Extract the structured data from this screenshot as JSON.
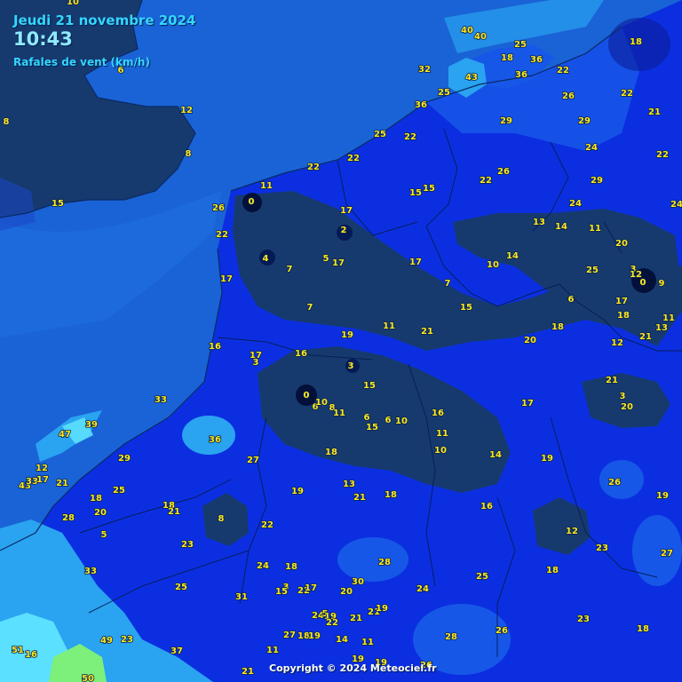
{
  "header": {
    "date": "Jeudi 21 novembre 2024",
    "time": "10:43",
    "parameter": "Rafales de vent (km/h)"
  },
  "copyright": "Copyright © 2024 Meteociel.fr",
  "colors": {
    "land_dark": "#163a6e",
    "land_mid": "#0b2fe0",
    "sea": "#1a63d6",
    "sea_light": "#2aa3f0",
    "strong": "#5be0ff",
    "very_strong": "#7cf07a",
    "label": "#ffe81f"
  },
  "stations": [
    {
      "v": "10"
    },
    {
      "v": "6"
    },
    {
      "v": "8"
    },
    {
      "v": "12"
    },
    {
      "v": "8"
    },
    {
      "v": "15"
    },
    {
      "v": "40"
    },
    {
      "v": "40"
    },
    {
      "v": "25"
    },
    {
      "v": "18"
    },
    {
      "v": "36"
    },
    {
      "v": "22"
    },
    {
      "v": "18"
    },
    {
      "v": "32"
    },
    {
      "v": "43"
    },
    {
      "v": "36"
    },
    {
      "v": "25"
    },
    {
      "v": "26"
    },
    {
      "v": "22"
    },
    {
      "v": "36"
    },
    {
      "v": "29"
    },
    {
      "v": "29"
    },
    {
      "v": "21"
    },
    {
      "v": "25"
    },
    {
      "v": "22"
    },
    {
      "v": "24"
    },
    {
      "v": "22"
    },
    {
      "v": "22"
    },
    {
      "v": "22"
    },
    {
      "v": "26"
    },
    {
      "v": "22"
    },
    {
      "v": "29"
    },
    {
      "v": "11"
    },
    {
      "v": "15"
    },
    {
      "v": "15"
    },
    {
      "v": "0"
    },
    {
      "v": "26"
    },
    {
      "v": "24"
    },
    {
      "v": "24"
    },
    {
      "v": "17"
    },
    {
      "v": "13"
    },
    {
      "v": "14"
    },
    {
      "v": "11"
    },
    {
      "v": "22"
    },
    {
      "v": "2"
    },
    {
      "v": "20"
    },
    {
      "v": "4"
    },
    {
      "v": "5"
    },
    {
      "v": "17"
    },
    {
      "v": "17"
    },
    {
      "v": "14"
    },
    {
      "v": "10"
    },
    {
      "v": "7"
    },
    {
      "v": "25"
    },
    {
      "v": "3"
    },
    {
      "v": "12"
    },
    {
      "v": "0"
    },
    {
      "v": "9"
    },
    {
      "v": "17"
    },
    {
      "v": "7"
    },
    {
      "v": "6"
    },
    {
      "v": "17"
    },
    {
      "v": "7"
    },
    {
      "v": "15"
    },
    {
      "v": "18"
    },
    {
      "v": "11"
    },
    {
      "v": "19"
    },
    {
      "v": "11"
    },
    {
      "v": "21"
    },
    {
      "v": "20"
    },
    {
      "v": "18"
    },
    {
      "v": "12"
    },
    {
      "v": "21"
    },
    {
      "v": "13"
    },
    {
      "v": "16"
    },
    {
      "v": "17"
    },
    {
      "v": "16"
    },
    {
      "v": "3"
    },
    {
      "v": "3"
    },
    {
      "v": "15"
    },
    {
      "v": "21"
    },
    {
      "v": "33"
    },
    {
      "v": "0"
    },
    {
      "v": "3"
    },
    {
      "v": "20"
    },
    {
      "v": "6"
    },
    {
      "v": "10"
    },
    {
      "v": "8"
    },
    {
      "v": "11"
    },
    {
      "v": "16"
    },
    {
      "v": "17"
    },
    {
      "v": "39"
    },
    {
      "v": "6"
    },
    {
      "v": "6"
    },
    {
      "v": "10"
    },
    {
      "v": "15"
    },
    {
      "v": "47"
    },
    {
      "v": "36"
    },
    {
      "v": "11"
    },
    {
      "v": "29"
    },
    {
      "v": "18"
    },
    {
      "v": "10"
    },
    {
      "v": "14"
    },
    {
      "v": "19"
    },
    {
      "v": "27"
    },
    {
      "v": "12"
    },
    {
      "v": "13"
    },
    {
      "v": "26"
    },
    {
      "v": "43"
    },
    {
      "v": "33"
    },
    {
      "v": "17"
    },
    {
      "v": "21"
    },
    {
      "v": "25"
    },
    {
      "v": "19"
    },
    {
      "v": "21"
    },
    {
      "v": "18"
    },
    {
      "v": "19"
    },
    {
      "v": "18"
    },
    {
      "v": "20"
    },
    {
      "v": "18"
    },
    {
      "v": "16"
    },
    {
      "v": "28"
    },
    {
      "v": "21"
    },
    {
      "v": "8"
    },
    {
      "v": "22"
    },
    {
      "v": "12"
    },
    {
      "v": "5"
    },
    {
      "v": "23"
    },
    {
      "v": "23"
    },
    {
      "v": "27"
    },
    {
      "v": "24"
    },
    {
      "v": "18"
    },
    {
      "v": "28"
    },
    {
      "v": "18"
    },
    {
      "v": "33"
    },
    {
      "v": "30"
    },
    {
      "v": "25"
    },
    {
      "v": "25"
    },
    {
      "v": "3"
    },
    {
      "v": "15"
    },
    {
      "v": "22"
    },
    {
      "v": "17"
    },
    {
      "v": "20"
    },
    {
      "v": "24"
    },
    {
      "v": "31"
    },
    {
      "v": "21"
    },
    {
      "v": "19"
    },
    {
      "v": "24"
    },
    {
      "v": "5"
    },
    {
      "v": "19"
    },
    {
      "v": "22"
    },
    {
      "v": "21"
    },
    {
      "v": "23"
    },
    {
      "v": "49"
    },
    {
      "v": "23"
    },
    {
      "v": "27"
    },
    {
      "v": "18"
    },
    {
      "v": "19"
    },
    {
      "v": "14"
    },
    {
      "v": "11"
    },
    {
      "v": "28"
    },
    {
      "v": "26"
    },
    {
      "v": "18"
    },
    {
      "v": "51"
    },
    {
      "v": "16"
    },
    {
      "v": "37"
    },
    {
      "v": "11"
    },
    {
      "v": "21"
    },
    {
      "v": "19"
    },
    {
      "v": "19"
    },
    {
      "v": "26"
    },
    {
      "v": "50"
    }
  ]
}
